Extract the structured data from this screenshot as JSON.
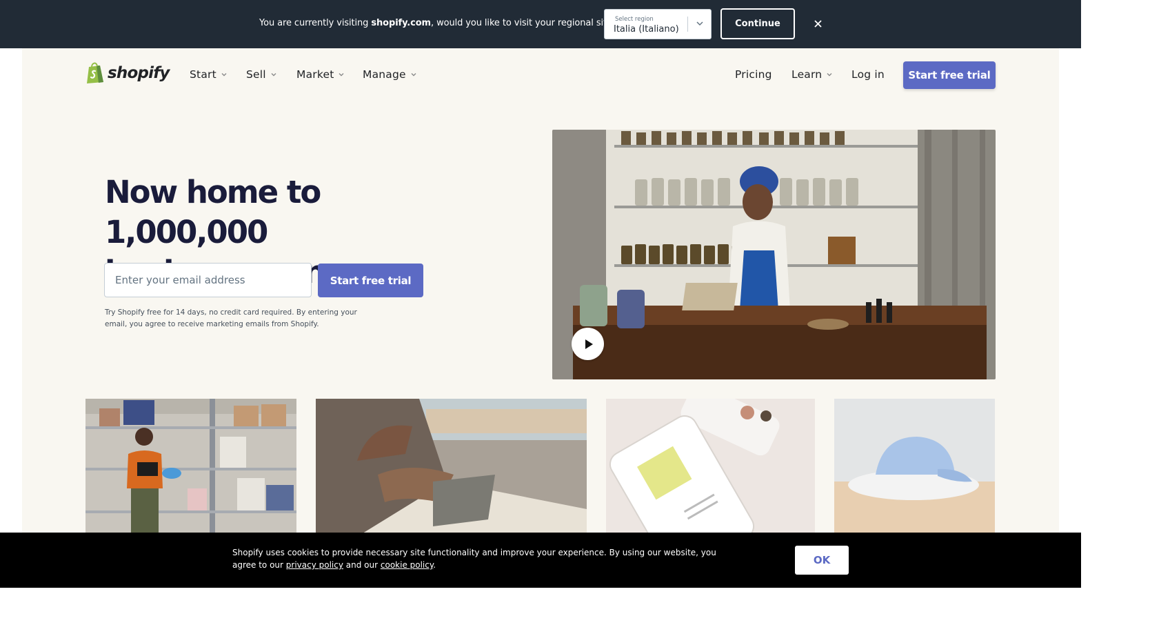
{
  "region_banner": {
    "text_before": "You are currently visiting ",
    "site": "shopify.com",
    "text_after": ", would you like to visit your regional site?",
    "select_label": "Select region",
    "select_value": "Italia (Italiano)",
    "continue_label": "Continue"
  },
  "header": {
    "logo_text": "shopify",
    "nav": [
      {
        "label": "Start"
      },
      {
        "label": "Sell"
      },
      {
        "label": "Market"
      },
      {
        "label": "Manage"
      }
    ],
    "right_nav": {
      "pricing": "Pricing",
      "learn": "Learn",
      "login": "Log in",
      "cta": "Start free trial"
    }
  },
  "hero": {
    "title_line1": "Now home to 1,000,000",
    "title_line2": "business owners",
    "email_placeholder": "Enter your email address",
    "cta": "Start free trial",
    "fineprint": "Try Shopify free for 14 days, no credit card required. By entering your email, you agree to receive marketing emails from Shopify."
  },
  "cookie": {
    "text_before": "Shopify uses cookies to provide necessary site functionality and improve your experience. By using our website, you agree to our ",
    "privacy_link": "privacy policy",
    "text_mid": " and our ",
    "cookie_link": "cookie policy",
    "text_end": ".",
    "ok_label": "OK"
  },
  "colors": {
    "banner_bg": "#212b36",
    "page_bg": "#f9f7f1",
    "brand_purple": "#5c6ac4",
    "heading": "#1a1c3b",
    "logo_green": "#95bf47"
  }
}
